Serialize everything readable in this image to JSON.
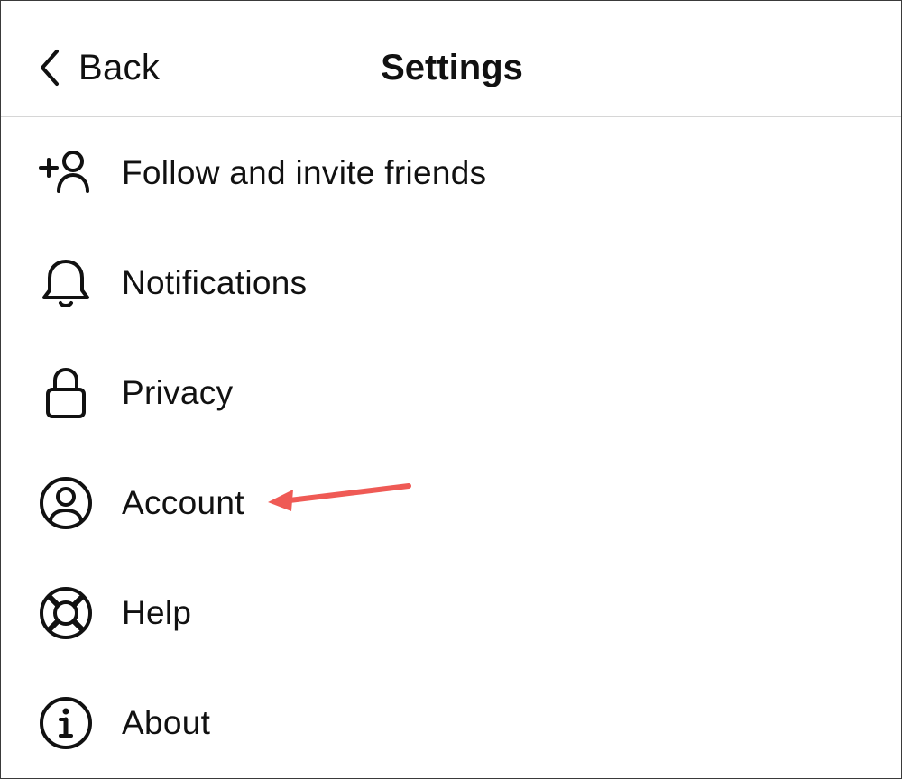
{
  "header": {
    "back_label": "Back",
    "title": "Settings"
  },
  "menu": {
    "items": [
      {
        "id": "follow",
        "label": "Follow and invite friends",
        "icon": "add-person-icon"
      },
      {
        "id": "notifications",
        "label": "Notifications",
        "icon": "bell-icon"
      },
      {
        "id": "privacy",
        "label": "Privacy",
        "icon": "lock-icon"
      },
      {
        "id": "account",
        "label": "Account",
        "icon": "account-circle-icon"
      },
      {
        "id": "help",
        "label": "Help",
        "icon": "lifebuoy-icon"
      },
      {
        "id": "about",
        "label": "About",
        "icon": "info-circle-icon"
      }
    ]
  },
  "annotation": {
    "arrow_color": "#ef5a55",
    "points_to": "account"
  },
  "colors": {
    "text": "#111111",
    "divider": "#d6d6d6",
    "background": "#ffffff"
  }
}
